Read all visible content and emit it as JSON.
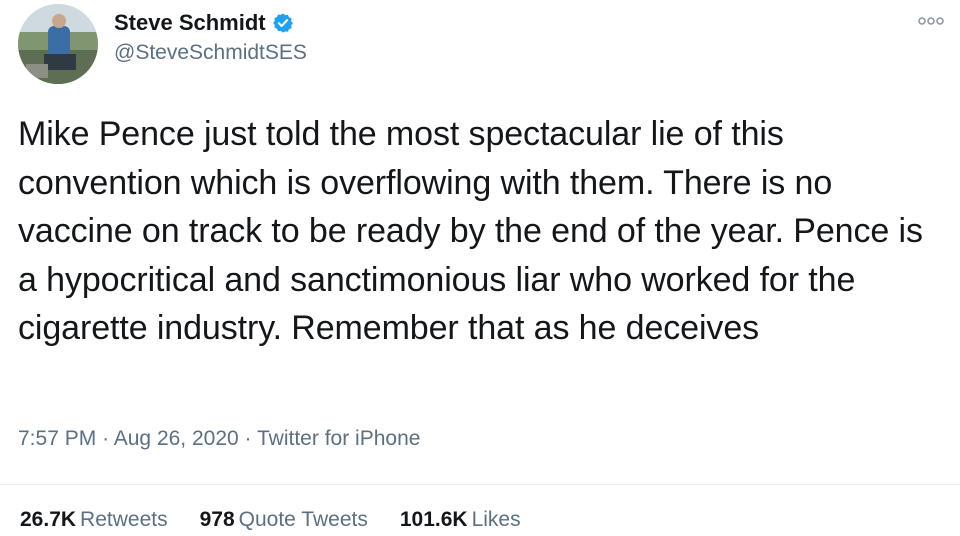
{
  "author": {
    "display_name": "Steve Schmidt",
    "handle": "@SteveSchmidtSES",
    "verified": true
  },
  "icons": {
    "verified": "verified-badge-icon",
    "more": "more-options-icon"
  },
  "colors": {
    "verified_badge": "#1da1f2",
    "secondary_text": "#5b7083"
  },
  "tweet": {
    "text": "Mike Pence just told the most spectacular lie of this convention which is overflowing with them. There is no vaccine on track to be ready by the end of the year. Pence is a hypocritical and sanctimonious liar who worked for the cigarette industry. Remember that as he deceives",
    "time": "7:57 PM",
    "date": "Aug 26, 2020",
    "source": "Twitter for iPhone",
    "separator": "·"
  },
  "stats": {
    "retweets_count": "26.7K",
    "retweets_label": "Retweets",
    "quotes_count": "978",
    "quotes_label": "Quote Tweets",
    "likes_count": "101.6K",
    "likes_label": "Likes"
  }
}
